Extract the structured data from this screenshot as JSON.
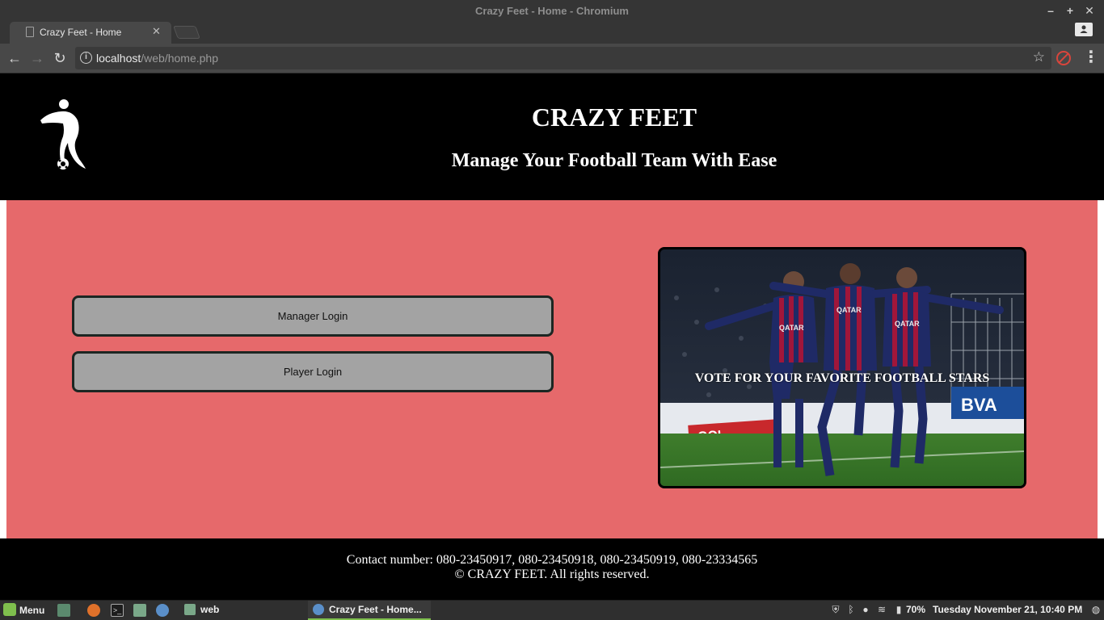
{
  "window": {
    "title": "Crazy Feet - Home - Chromium",
    "controls": {
      "minimize": "–",
      "maximize": "+",
      "close": "✕"
    }
  },
  "tabs": [
    {
      "label": "Crazy Feet - Home",
      "close": "✕"
    }
  ],
  "toolbar": {
    "back": "←",
    "forward": "→",
    "reload": "↻",
    "url_host": "localhost",
    "url_path": "/web/home.php",
    "info": "i",
    "star": "☆",
    "menu": "⋮"
  },
  "site": {
    "title": "CRAZY FEET",
    "tagline": "Manage Your Football Team With Ease",
    "buttons": {
      "manager_login": "Manager Login",
      "player_login": "Player Login"
    },
    "promo_caption": "VOTE FOR YOUR FAVORITE FOOTBALL STARS",
    "footer": {
      "contact": "Contact number: 080-23450917, 080-23450918, 080-23450919, 080-23334565",
      "copyright": "© CRAZY FEET. All rights reserved."
    }
  },
  "taskbar": {
    "menu_label": "Menu",
    "folder_label": "web",
    "active_window": "Crazy Feet - Home...",
    "battery": "70%",
    "clock": "Tuesday November 21, 10:40 PM"
  },
  "colors": {
    "page_background": "#e6696b",
    "header_background": "#000000",
    "button_background": "#a3a3a3",
    "button_border": "#1c2622"
  }
}
